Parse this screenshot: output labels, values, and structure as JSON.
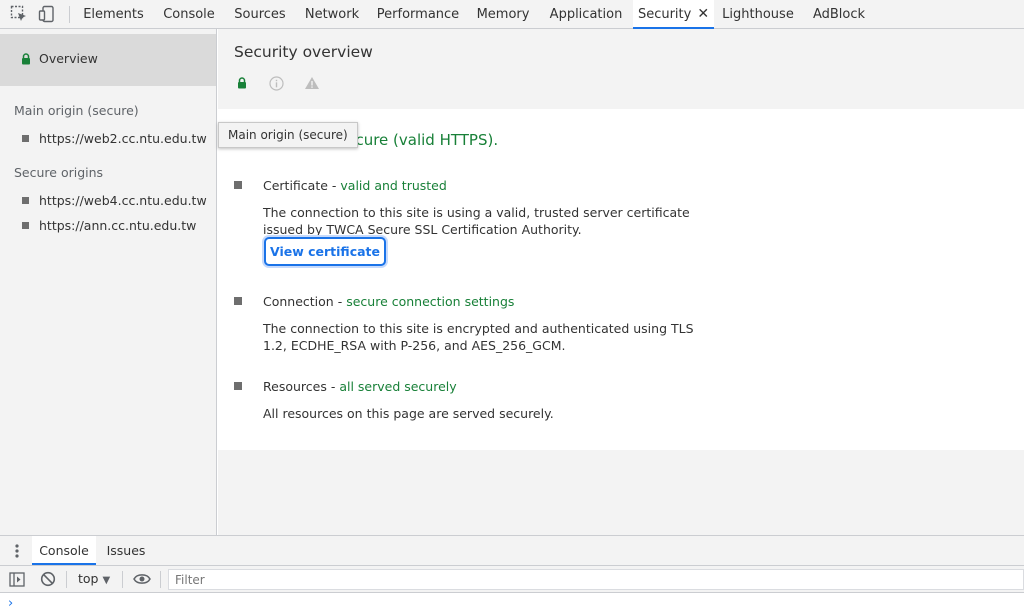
{
  "toolbar": {
    "inspect_icon": "inspect-element-icon",
    "device_icon": "device-toolbar-icon"
  },
  "tabs": [
    {
      "label": "Elements"
    },
    {
      "label": "Console"
    },
    {
      "label": "Sources"
    },
    {
      "label": "Network"
    },
    {
      "label": "Performance"
    },
    {
      "label": "Memory"
    },
    {
      "label": "Application"
    },
    {
      "label": "Security",
      "active": true,
      "close_glyph": "✕"
    },
    {
      "label": "Lighthouse"
    },
    {
      "label": "AdBlock"
    }
  ],
  "sidebar": {
    "overview_label": "Overview",
    "main_origin_heading": "Main origin (secure)",
    "main_origin": "https://web2.cc.ntu.edu.tw",
    "secure_origins_heading": "Secure origins",
    "secure_origins": [
      "https://web4.cc.ntu.edu.tw",
      "https://ann.cc.ntu.edu.tw"
    ]
  },
  "main": {
    "title": "Security overview",
    "summary": "This page is secure (valid HTTPS).",
    "tooltip": "Main origin (secure)",
    "sections": [
      {
        "title": "Certificate",
        "status": "valid and trusted",
        "description": "The connection to this site is using a valid, trusted server certificate issued by TWCA Secure SSL Certification Authority.",
        "button": "View certificate"
      },
      {
        "title": "Connection",
        "status": "secure connection settings",
        "description": "The connection to this site is encrypted and authenticated using TLS 1.2, ECDHE_RSA with P-256, and AES_256_GCM."
      },
      {
        "title": "Resources",
        "status": "all served securely",
        "description": "All resources on this page are served securely."
      }
    ]
  },
  "drawer": {
    "tabs": [
      "Console",
      "Issues"
    ],
    "context": "top",
    "filter_placeholder": "Filter",
    "prompt": "›"
  },
  "colors": {
    "accent": "#1a73e8",
    "secure_green": "#188038"
  }
}
